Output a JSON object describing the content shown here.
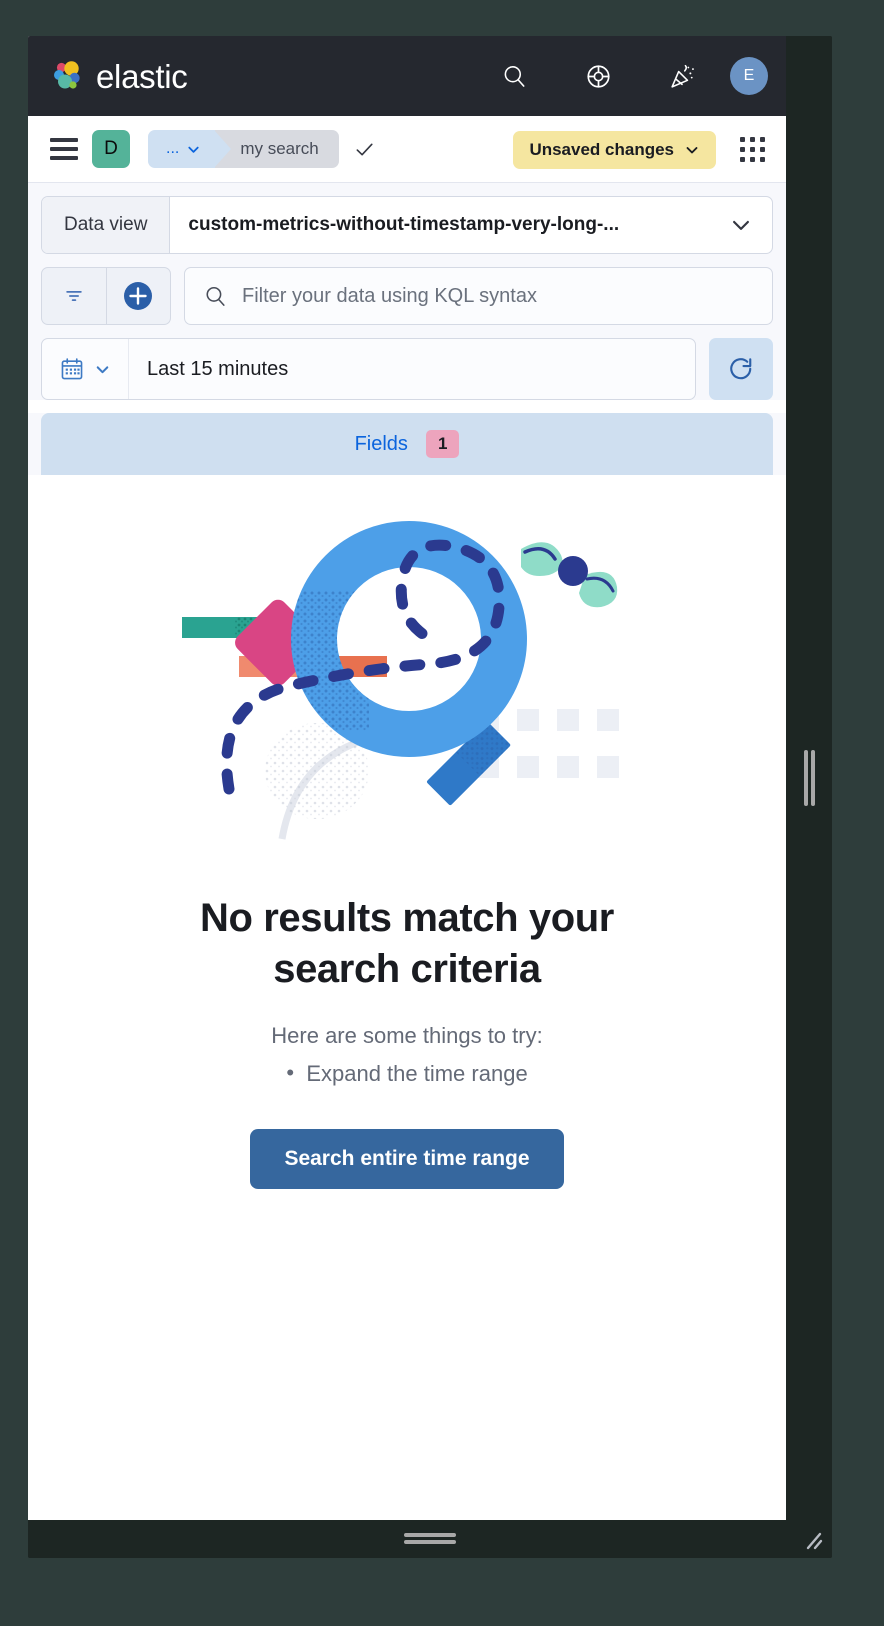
{
  "chrome": {
    "brand": "elastic",
    "icons": {
      "search": "search-icon",
      "help": "help-lifebuoy-icon",
      "whats_new": "party-popper-icon"
    },
    "avatar_initial": "E"
  },
  "nav": {
    "menu_icon": "hamburger-menu-icon",
    "app_badge": "D",
    "breadcrumb": {
      "ellipsis": "...",
      "current": "my search"
    },
    "unsaved_label": "Unsaved changes",
    "grid_icon": "app-grid-icon"
  },
  "query": {
    "dataview_label": "Data view",
    "dataview_value": "custom-metrics-without-timestamp-very-long-...",
    "kql_placeholder": "Filter your data using KQL syntax",
    "filter_icon": "filter-icon",
    "add_filter_icon": "add-filter-plus-icon",
    "date_value": "Last 15 minutes",
    "calendar_icon": "calendar-icon",
    "refresh_icon": "refresh-icon"
  },
  "tabs": {
    "fields_label": "Fields",
    "fields_count": "1"
  },
  "empty_state": {
    "illustration": "magnifying-glass-no-results-illustration",
    "title": "No results match your search criteria",
    "subtitle": "Here are some things to try:",
    "suggestions": [
      "Expand the time range"
    ],
    "cta_label": "Search entire time range"
  },
  "colors": {
    "chrome_bg": "#25282f",
    "accent_blue": "#0b64dd",
    "button_blue": "#36679e",
    "app_badge_teal": "#54b399",
    "unsaved_yellow": "#f5e6a0",
    "badge_pink": "#eda4bd",
    "tab_blue": "#cfdff0",
    "desktop_bg": "#2e3d3b"
  }
}
